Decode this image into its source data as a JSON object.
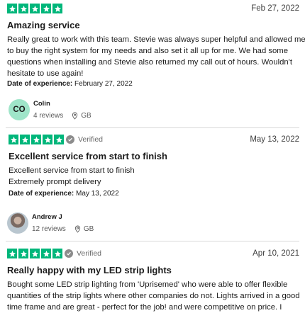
{
  "reviews": [
    {
      "rating": 5,
      "verified": false,
      "date": "Feb 27, 2022",
      "title": "Amazing service",
      "body_lines": [
        "Really great to work with this team. Stevie was always super helpful and allowed me",
        "to buy the right system for my needs and also set it all up for me. We had some",
        "questions when installing and Stevie also returned my call out of hours. Wouldn't",
        "hesitate to use again!"
      ],
      "experience_label": "Date of experience:",
      "experience_date": "February 27, 2022"
    },
    {
      "rating": 5,
      "verified": true,
      "verified_label": "Verified",
      "date": "May 13, 2022",
      "title": "Excellent service from start to finish",
      "body_lines": [
        "Excellent service from start to finish",
        "Extremely prompt delivery"
      ],
      "experience_label": "Date of experience:",
      "experience_date": "May 13, 2022"
    },
    {
      "rating": 5,
      "verified": true,
      "verified_label": "Verified",
      "date": "Apr 10, 2021",
      "title": "Really happy with my LED strip lights",
      "body_lines": [
        "Bought some LED strip lighting from 'Uprisemed' who were able to offer flexible",
        "quantities of the strip lights where other companies do not. Lights arrived in a good",
        "time frame and are great - perfect for the job! and were competitive on price. I"
      ]
    }
  ],
  "reviewers": [
    {
      "name": "Colin",
      "initials": "CO",
      "reviews": "4 reviews",
      "country": "GB",
      "avatar": "initials",
      "avatar_color": "#9fe5c9"
    },
    {
      "name": "Andrew J",
      "reviews": "12 reviews",
      "country": "GB",
      "avatar": "photo"
    }
  ],
  "colors": {
    "star": "#00b67a",
    "verified": "#8c8c8c",
    "divider": "#d8d8d8"
  },
  "icons": {
    "star": "star-icon",
    "verified": "check-circle-icon",
    "location": "location-pin-icon"
  }
}
